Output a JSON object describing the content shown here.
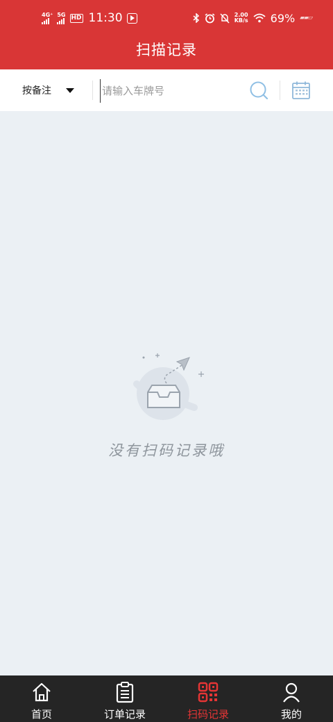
{
  "status_bar": {
    "network1": "4G⁺",
    "network2": "5G",
    "hd_badge": "HD",
    "time": "11:30",
    "speed_value": "2.00",
    "speed_unit": "KB/s",
    "battery": "69%"
  },
  "header": {
    "title": "扫描记录"
  },
  "filter": {
    "selected": "按备注",
    "input_value": "",
    "placeholder": "请输入车牌号"
  },
  "empty_state": {
    "message": "没有扫码记录哦"
  },
  "tabs": [
    {
      "label": "首页",
      "icon": "home-icon",
      "active": false
    },
    {
      "label": "订单记录",
      "icon": "clipboard-icon",
      "active": false
    },
    {
      "label": "扫码记录",
      "icon": "qr-code-icon",
      "active": true
    },
    {
      "label": "我的",
      "icon": "user-icon",
      "active": false
    }
  ],
  "colors": {
    "header_bg": "#d93636",
    "content_bg": "#ebf0f4",
    "tabbar_bg": "#252525",
    "active_tab": "#e53535",
    "search_icon": "#8fbfe4",
    "calendar_icon": "#8fb8da"
  }
}
